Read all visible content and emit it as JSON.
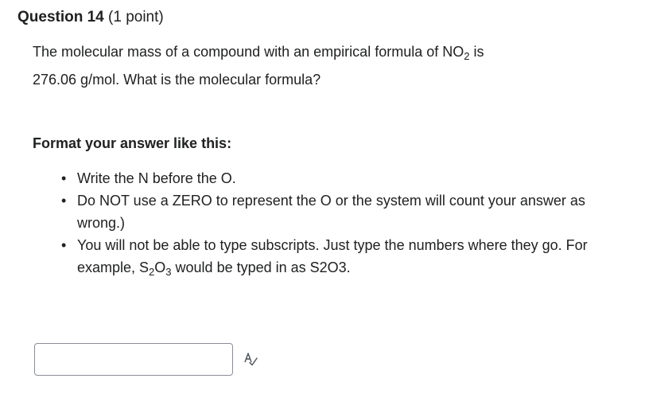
{
  "question": {
    "title": "Question 14",
    "points": "(1 point)",
    "prompt": {
      "line1_prefix": "The molecular mass of a compound with an empirical formula of NO",
      "line1_sub": "2",
      "line1_suffix": " is",
      "line2": "276.06 g/mol. What is the molecular formula?"
    }
  },
  "format": {
    "heading": "Format your answer like this:",
    "rules": [
      {
        "text": "Write the N before the O."
      },
      {
        "text": "Do NOT use a ZERO to represent the O or the system will count your answer as wrong.)"
      },
      {
        "prefix": "You will not be able to type subscripts. Just type the numbers where they go. For example, S",
        "sub1": "2",
        "mid": "O",
        "sub2": "3",
        "suffix": " would be typed in as S2O3."
      }
    ]
  },
  "answer": {
    "value": "",
    "placeholder": ""
  },
  "icons": {
    "spellcheck": "spellcheck-icon"
  }
}
